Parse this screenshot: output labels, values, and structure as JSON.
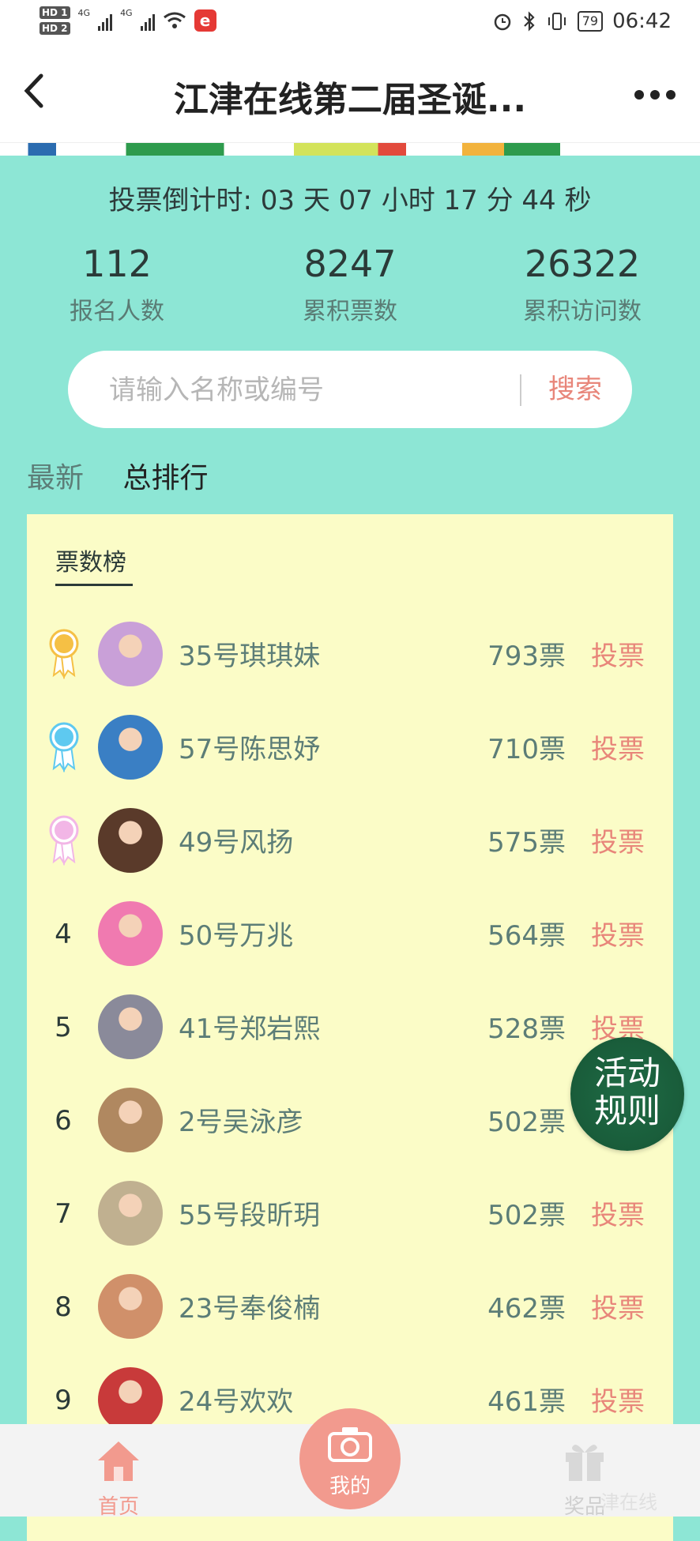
{
  "status": {
    "hd1": "HD 1",
    "hd2": "HD 2",
    "net1": "4G",
    "net2": "4G",
    "battery": "79",
    "time": "06:42"
  },
  "nav": {
    "title": "江津在线第二届圣诞..."
  },
  "countdown": "投票倒计时: 03 天 07 小时 17 分 44 秒",
  "stats": [
    {
      "value": "112",
      "label": "报名人数"
    },
    {
      "value": "8247",
      "label": "累积票数"
    },
    {
      "value": "26322",
      "label": "累积访问数"
    }
  ],
  "search": {
    "placeholder": "请输入名称或编号",
    "button": "搜索"
  },
  "tabs": {
    "latest": "最新",
    "total": "总排行"
  },
  "ranking": {
    "title": "票数榜",
    "vote_label": "投票",
    "rows": [
      {
        "rank": "",
        "medal": "gold",
        "name": "35号琪琪妹",
        "votes": "793票"
      },
      {
        "rank": "",
        "medal": "blue",
        "name": "57号陈思妤",
        "votes": "710票"
      },
      {
        "rank": "",
        "medal": "pink",
        "name": "49号风扬",
        "votes": "575票"
      },
      {
        "rank": "4",
        "medal": "",
        "name": "50号万兆",
        "votes": "564票"
      },
      {
        "rank": "5",
        "medal": "",
        "name": "41号郑岩熙",
        "votes": "528票"
      },
      {
        "rank": "6",
        "medal": "",
        "name": "2号吴泳彦",
        "votes": "502票"
      },
      {
        "rank": "7",
        "medal": "",
        "name": "55号段昕玥",
        "votes": "502票"
      },
      {
        "rank": "8",
        "medal": "",
        "name": "23号奉俊楠",
        "votes": "462票"
      },
      {
        "rank": "9",
        "medal": "",
        "name": "24号欢欢",
        "votes": "461票"
      }
    ]
  },
  "floating": {
    "line1": "活动",
    "line2": "规则"
  },
  "tabbar": {
    "home": "首页",
    "mine": "我的",
    "gift": "奖品"
  },
  "watermark": "津在线",
  "colors": {
    "background": "#8de6d5",
    "card": "#fbfcc7",
    "accent": "#e8867a",
    "text_muted": "#5c7d77"
  }
}
